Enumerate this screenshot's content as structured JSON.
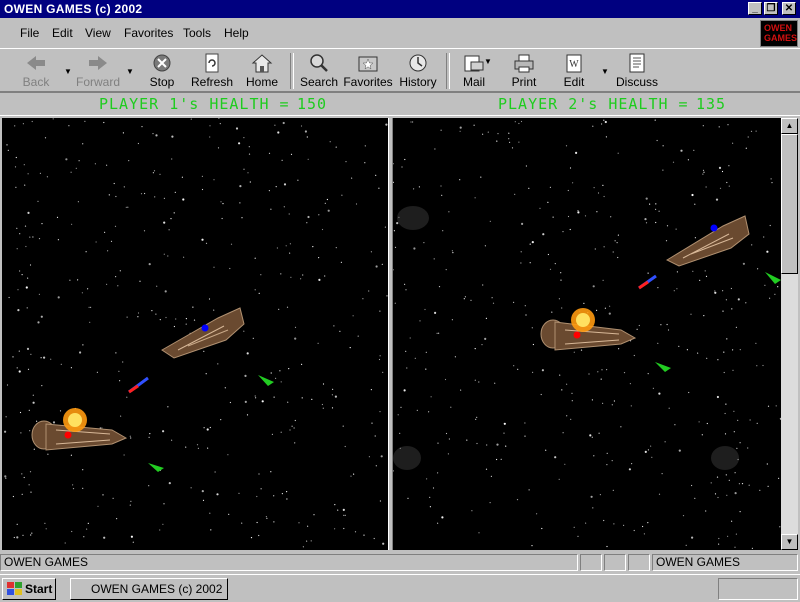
{
  "window": {
    "title": "OWEN GAMES (c) 2002",
    "minimize": "_",
    "restore": "❐",
    "close": "✕"
  },
  "menu": [
    "File",
    "Edit",
    "View",
    "Favorites",
    "Tools",
    "Help"
  ],
  "logo": {
    "line1": "OWEN",
    "line2": "GAMES"
  },
  "toolbar": {
    "back": "Back",
    "forward": "Forward",
    "stop": "Stop",
    "refresh": "Refresh",
    "home": "Home",
    "search": "Search",
    "favorites": "Favorites",
    "history": "History",
    "mail": "Mail",
    "print": "Print",
    "edit": "Edit",
    "discuss": "Discuss"
  },
  "health": {
    "player1_label": "PLAYER 1's HEALTH =",
    "player1_value": "150",
    "player2_label": "PLAYER 2's HEALTH =",
    "player2_value": "135"
  },
  "colors": {
    "health_text": "#1ecc1e",
    "titlebar": "#000080",
    "player1_marker": "#ff0000",
    "player2_marker": "#0000ff",
    "powerup": "#22cc22"
  },
  "status": {
    "left": "OWEN GAMES",
    "right": "OWEN GAMES"
  },
  "taskbar": {
    "start": "Start",
    "task": "OWEN GAMES (c) 2002"
  }
}
